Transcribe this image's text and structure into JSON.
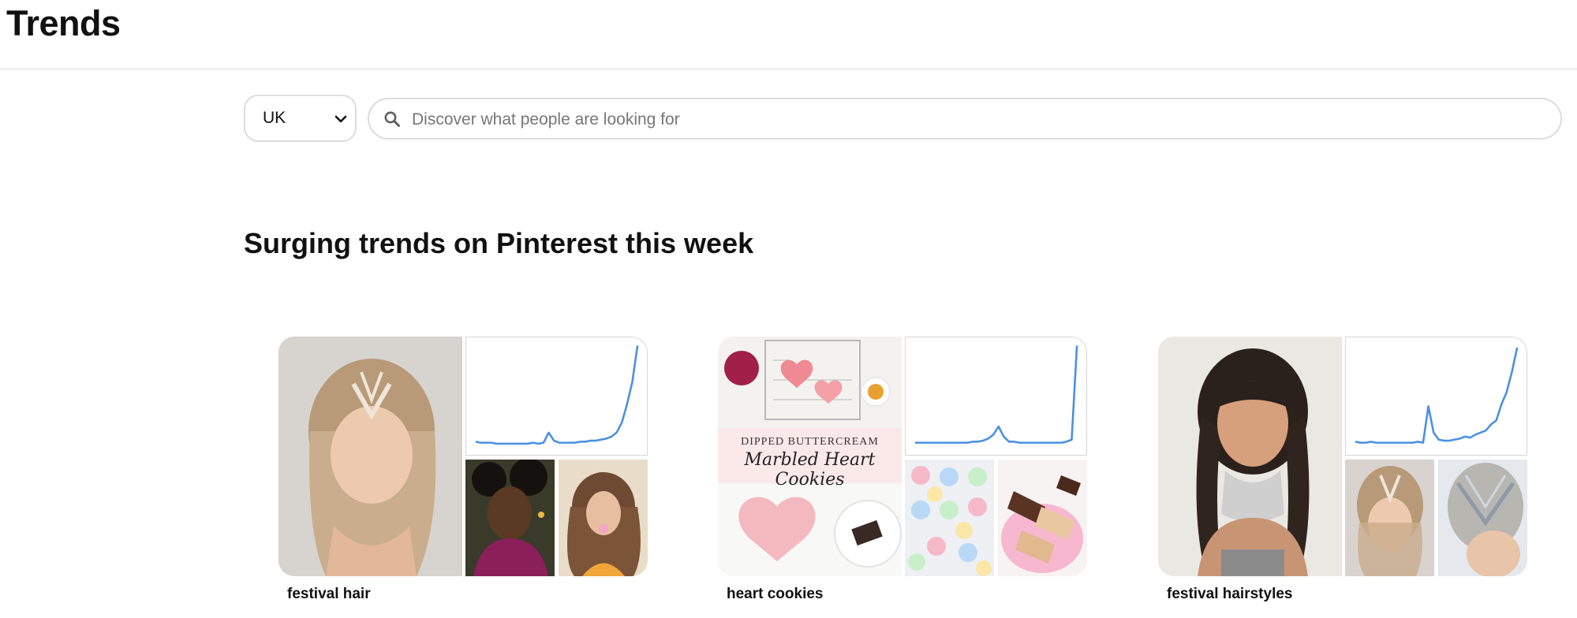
{
  "header": {
    "title": "Trends"
  },
  "filters": {
    "country": {
      "selected": "UK"
    },
    "search": {
      "placeholder": "Discover what people are looking for",
      "value": ""
    }
  },
  "section": {
    "title": "Surging trends on Pinterest this week"
  },
  "trends": [
    {
      "label": "festival hair",
      "sparkline": [
        3,
        2,
        2,
        2,
        1,
        1,
        1,
        1,
        1,
        1,
        1,
        2,
        1,
        2,
        12,
        4,
        2,
        2,
        2,
        2,
        3,
        3,
        4,
        4,
        5,
        6,
        8,
        12,
        22,
        40,
        62,
        98
      ]
    },
    {
      "label": "heart cookies",
      "sparkline": [
        2,
        2,
        2,
        2,
        2,
        2,
        2,
        2,
        2,
        2,
        2,
        3,
        3,
        4,
        6,
        10,
        18,
        8,
        3,
        3,
        2,
        2,
        2,
        2,
        2,
        2,
        2,
        2,
        2,
        3,
        5,
        98
      ],
      "image_text": {
        "line1": "DIPPED BUTTERCREAM",
        "line2": "Marbled Heart Cookies"
      }
    },
    {
      "label": "festival hairstyles",
      "sparkline": [
        3,
        2,
        2,
        3,
        2,
        2,
        2,
        2,
        2,
        2,
        2,
        2,
        3,
        2,
        38,
        12,
        5,
        4,
        4,
        5,
        6,
        8,
        7,
        10,
        12,
        14,
        20,
        24,
        40,
        52,
        72,
        96
      ]
    }
  ]
}
